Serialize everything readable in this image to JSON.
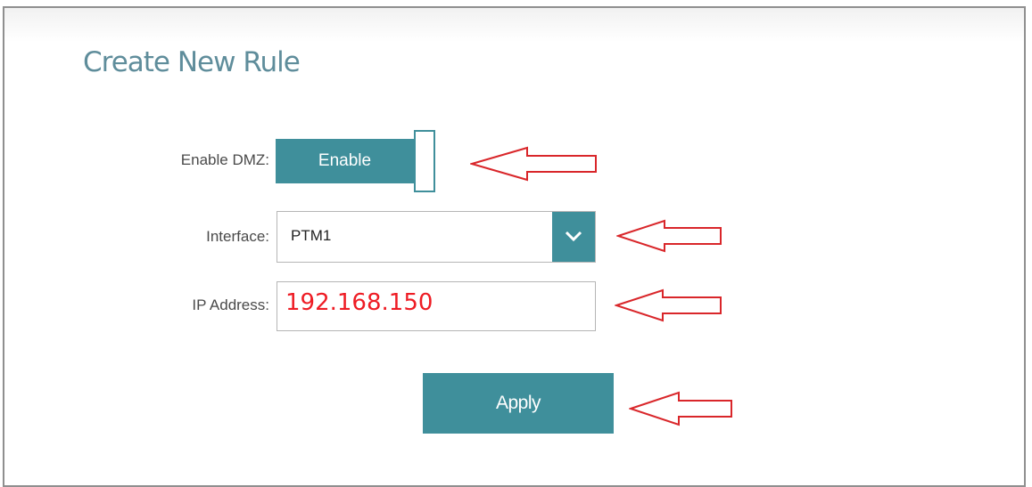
{
  "form": {
    "title": "Create New Rule",
    "enable_dmz": {
      "label": "Enable DMZ:",
      "toggle_text": "Enable"
    },
    "interface": {
      "label": "Interface:",
      "selected": "PTM1"
    },
    "ip_address": {
      "label": "IP Address:",
      "value": "192.168.150"
    },
    "apply_label": "Apply"
  },
  "colors": {
    "accent": "#3f8f9b",
    "title": "#5f8d9b",
    "annotation_arrow": "#d9262a",
    "ip_text": "#ee1c24"
  },
  "annotations": {
    "arrow_icon": "red-outline-left-arrow"
  }
}
